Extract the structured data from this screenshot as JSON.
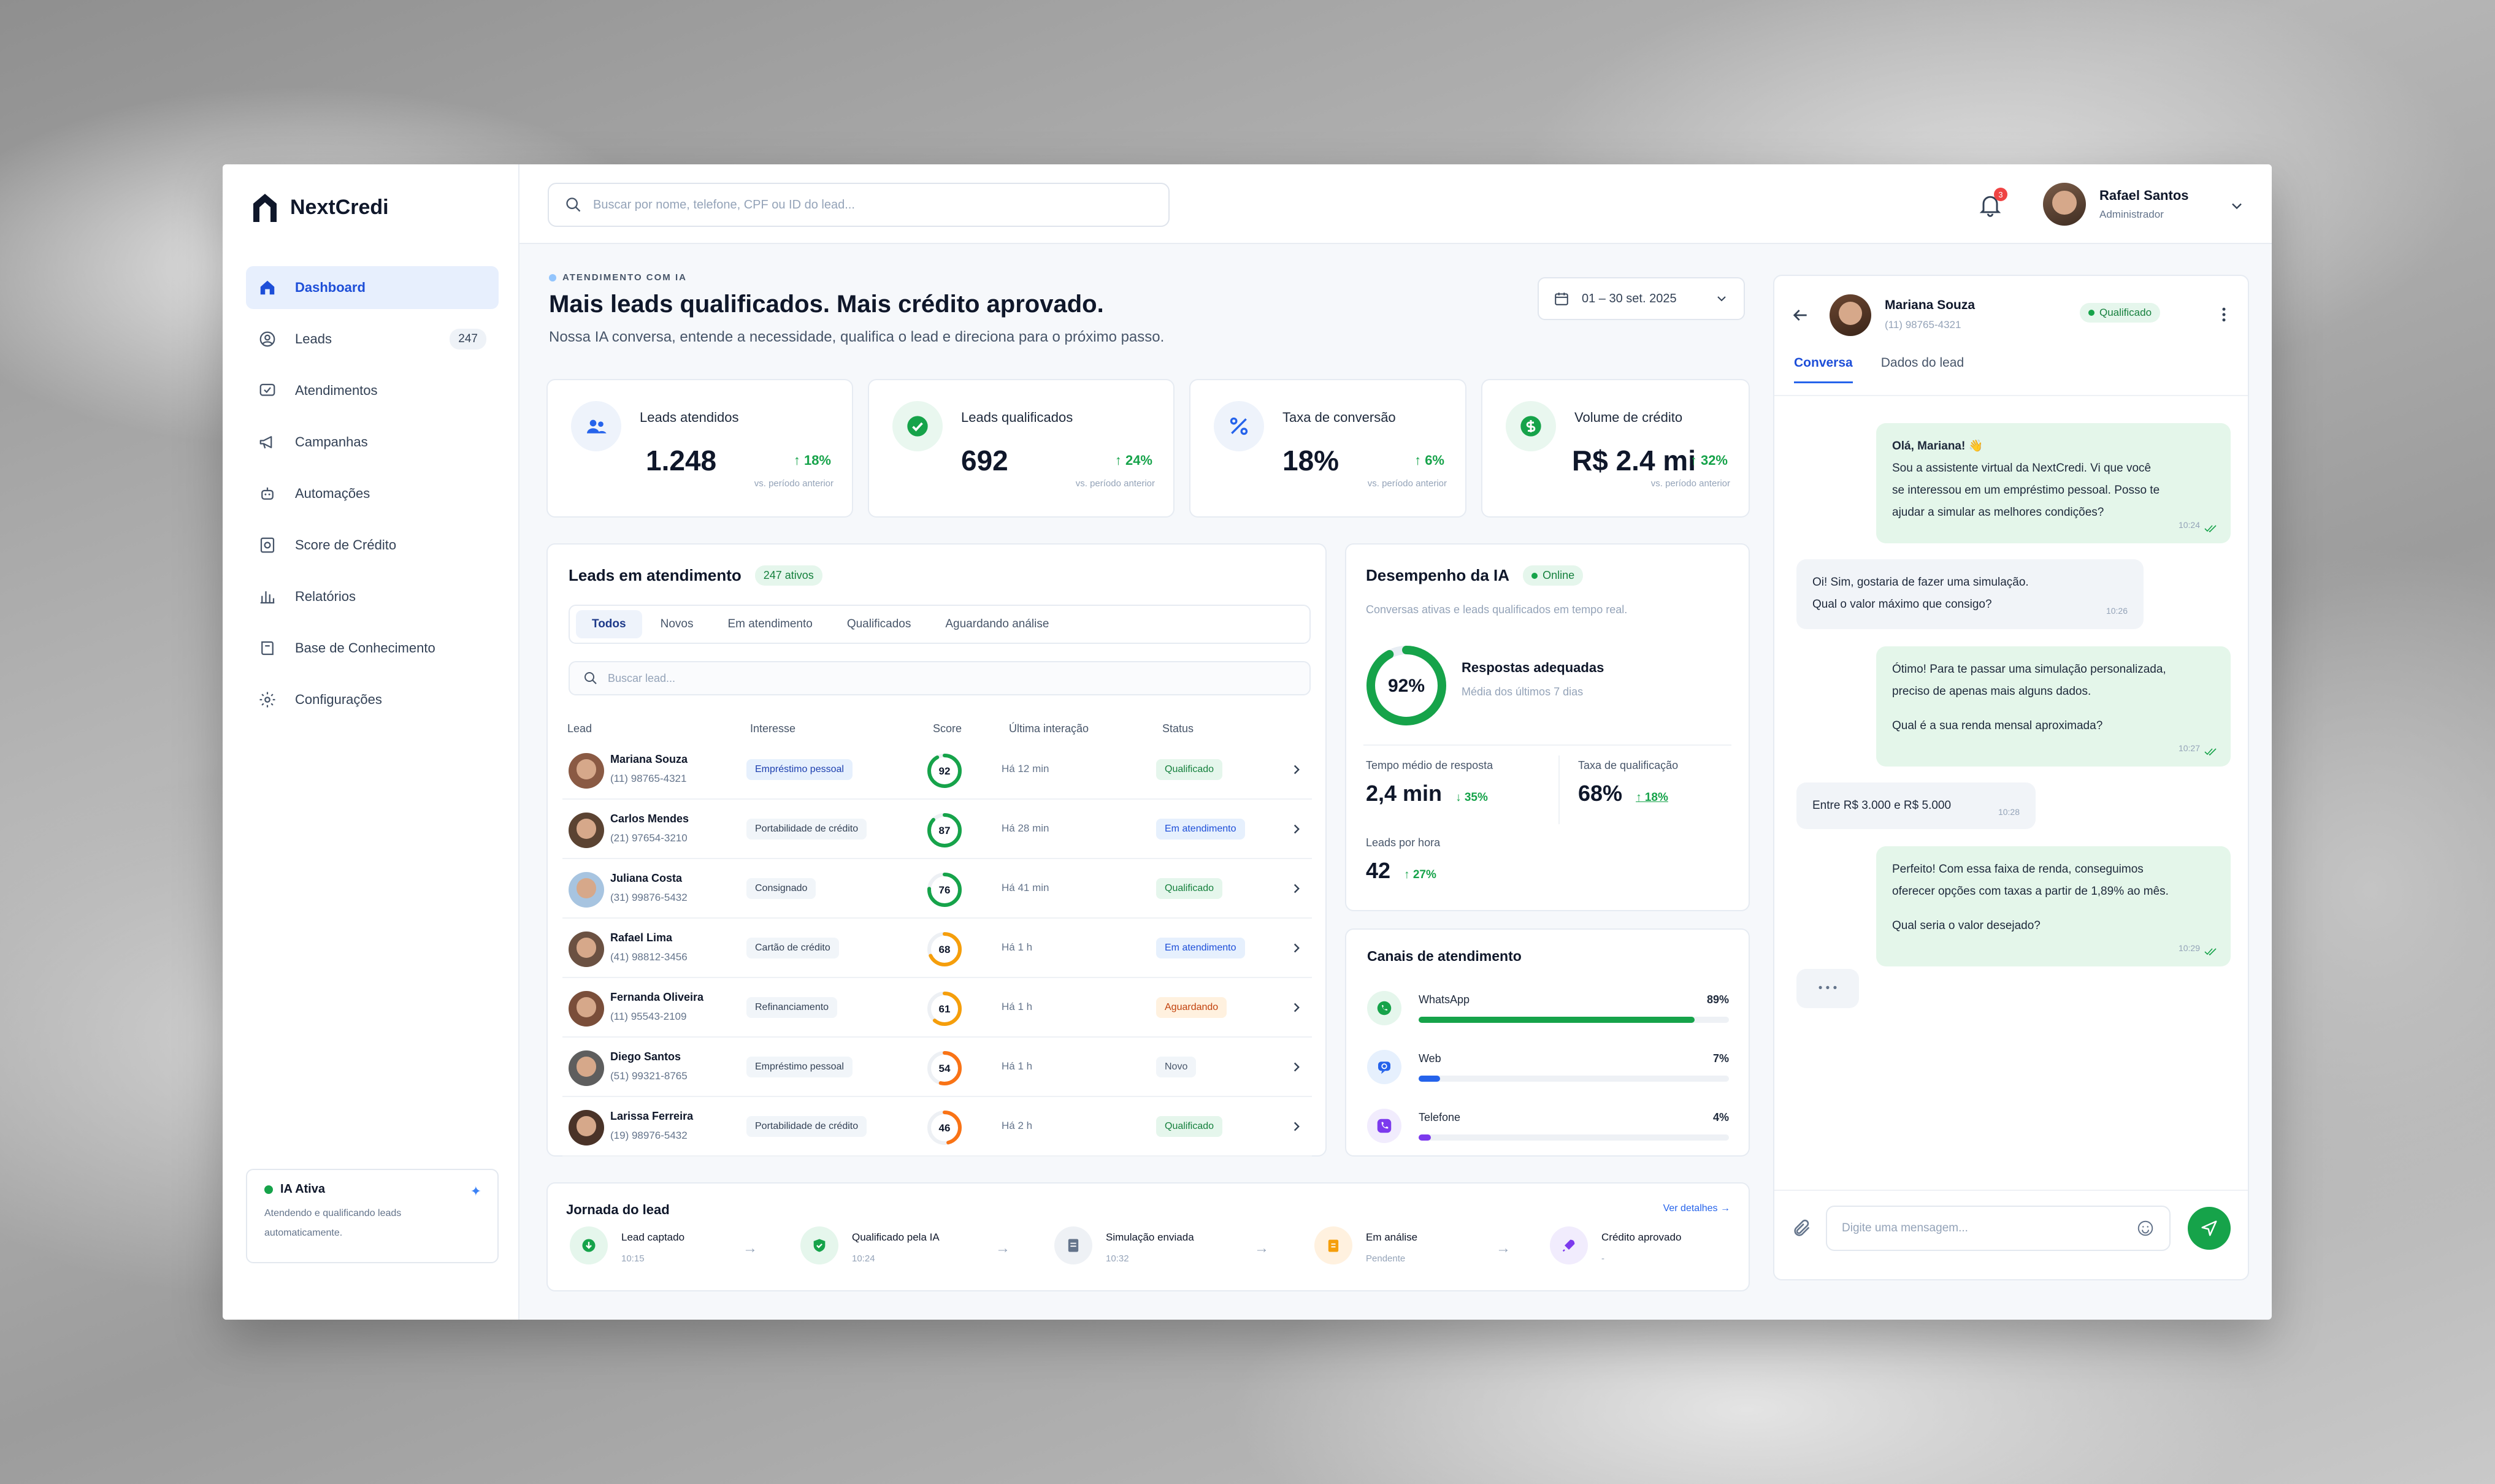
{
  "brand": {
    "name": "NextCredi"
  },
  "search": {
    "placeholder": "Buscar por nome, telefone, CPF ou ID do lead..."
  },
  "notifications": {
    "count": "3"
  },
  "user": {
    "name": "Rafael Santos",
    "role": "Administrador"
  },
  "sidebar": {
    "items": [
      {
        "label": "Dashboard",
        "icon": "home-icon",
        "active": true
      },
      {
        "label": "Leads",
        "icon": "user-circle-icon",
        "badge": "247"
      },
      {
        "label": "Atendimentos",
        "icon": "chat-icon"
      },
      {
        "label": "Campanhas",
        "icon": "megaphone-icon"
      },
      {
        "label": "Automações",
        "icon": "robot-icon"
      },
      {
        "label": "Score de Crédito",
        "icon": "score-icon"
      },
      {
        "label": "Relatórios",
        "icon": "bar-chart-icon"
      },
      {
        "label": "Base de Conhecimento",
        "icon": "book-icon"
      },
      {
        "label": "Configurações",
        "icon": "gear-icon"
      }
    ],
    "ia_card": {
      "title": "IA Ativa",
      "desc": "Atendendo e qualificando leads automaticamente."
    }
  },
  "header": {
    "eyebrow": "ATENDIMENTO COM IA",
    "title": "Mais leads qualificados. Mais crédito aprovado.",
    "subtitle": "Nossa IA conversa, entende a necessidade, qualifica o lead e direciona para o próximo passo.",
    "date_range": "01 – 30 set. 2025"
  },
  "kpis": [
    {
      "label": "Leads atendidos",
      "value": "1.248",
      "delta": "↑ 18%",
      "note": "vs. período anterior",
      "icon": "users-icon",
      "color": "#2563eb"
    },
    {
      "label": "Leads qualificados",
      "value": "692",
      "delta": "↑ 24%",
      "note": "vs. período anterior",
      "icon": "check-circle-icon",
      "color": "#16a34a"
    },
    {
      "label": "Taxa de conversão",
      "value": "18%",
      "delta": "↑ 6%",
      "note": "vs. período anterior",
      "icon": "percent-icon",
      "color": "#2563eb"
    },
    {
      "label": "Volume de crédito",
      "value": "R$ 2.4 mi",
      "delta": "↑ 32%",
      "note": "vs. período anterior",
      "icon": "dollar-icon",
      "color": "#16a34a"
    }
  ],
  "leads": {
    "title": "Leads em atendimento",
    "active_badge": "247 ativos",
    "tabs": [
      "Todos",
      "Novos",
      "Em atendimento",
      "Qualificados",
      "Aguardando análise"
    ],
    "search_placeholder": "Buscar lead...",
    "columns": [
      "Lead",
      "Interesse",
      "Score",
      "Última interação",
      "Status"
    ],
    "rows": [
      {
        "name": "Mariana Souza",
        "phone": "(11) 98765-4321",
        "interest": "Empréstimo pessoal",
        "score": 92,
        "last": "Há 12 min",
        "status": "Qualificado",
        "kind": "q",
        "blue": true
      },
      {
        "name": "Carlos Mendes",
        "phone": "(21) 97654-3210",
        "interest": "Portabilidade de crédito",
        "score": 87,
        "last": "Há 28 min",
        "status": "Em atendimento",
        "kind": "a",
        "blue": false
      },
      {
        "name": "Juliana Costa",
        "phone": "(31) 99876-5432",
        "interest": "Consignado",
        "score": 76,
        "last": "Há 41 min",
        "status": "Qualificado",
        "kind": "q",
        "blue": false
      },
      {
        "name": "Rafael Lima",
        "phone": "(41) 98812-3456",
        "interest": "Cartão de crédito",
        "score": 68,
        "last": "Há 1 h",
        "status": "Em atendimento",
        "kind": "a",
        "blue": false
      },
      {
        "name": "Fernanda Oliveira",
        "phone": "(11) 95543-2109",
        "interest": "Refinanciamento",
        "score": 61,
        "last": "Há 1 h",
        "status": "Aguardando",
        "kind": "w",
        "blue": false
      },
      {
        "name": "Diego Santos",
        "phone": "(51) 99321-8765",
        "interest": "Empréstimo pessoal",
        "score": 54,
        "last": "Há 1 h",
        "status": "Novo",
        "kind": "n",
        "blue": false
      },
      {
        "name": "Larissa Ferreira",
        "phone": "(19) 98976-5432",
        "interest": "Portabilidade de crédito",
        "score": 46,
        "last": "Há 2 h",
        "status": "Qualificado",
        "kind": "q",
        "blue": false
      }
    ]
  },
  "journey": {
    "title": "Jornada do lead",
    "link": "Ver detalhes →",
    "steps": [
      {
        "title": "Lead captado",
        "sub": "10:15",
        "icon": "download-icon",
        "bg": "#e5f6ec",
        "fg": "#16a34a"
      },
      {
        "title": "Qualificado pela IA",
        "sub": "10:24",
        "icon": "shield-check-icon",
        "bg": "#e5f6ec",
        "fg": "#16a34a"
      },
      {
        "title": "Simulação enviada",
        "sub": "10:32",
        "icon": "document-icon",
        "bg": "#eef1f5",
        "fg": "#64748b"
      },
      {
        "title": "Em análise",
        "sub": "Pendente",
        "icon": "clipboard-icon",
        "bg": "#fff1df",
        "fg": "#f59e0b"
      },
      {
        "title": "Crédito aprovado",
        "sub": "-",
        "icon": "rocket-icon",
        "bg": "#f1ecfd",
        "fg": "#7c3aed"
      }
    ]
  },
  "performance": {
    "title": "Desempenho da IA",
    "status": "Online",
    "subtitle": "Conversas ativas e leads qualificados em tempo real.",
    "ring_value": 0.92,
    "ring_label": "92%",
    "ring_title": "Respostas adequadas",
    "ring_sub": "Média dos últimos 7 dias",
    "metrics": [
      {
        "label": "Tempo médio de resposta",
        "value": "2,4 min",
        "delta": "↓ 35%"
      },
      {
        "label": "Taxa de qualificação",
        "value": "68%",
        "delta": "↑ 18%"
      },
      {
        "label": "Leads por hora",
        "value": "42",
        "delta": "↑ 27%"
      }
    ]
  },
  "channels": {
    "title": "Canais de atendimento",
    "items": [
      {
        "name": "WhatsApp",
        "pct": "89%",
        "value": 0.89,
        "color": "#16a34a",
        "icon": "whatsapp-icon",
        "bg": "#e5f6ec"
      },
      {
        "name": "Web",
        "pct": "7%",
        "value": 0.07,
        "color": "#2563eb",
        "icon": "globe-chat-icon",
        "bg": "#e6f0fd"
      },
      {
        "name": "Telefone",
        "pct": "4%",
        "value": 0.04,
        "color": "#7c3aed",
        "icon": "phone-icon",
        "bg": "#f1ecfd"
      }
    ]
  },
  "chat": {
    "contact_name": "Mariana Souza",
    "contact_phone": "(11) 98765-4321",
    "contact_status": "Qualificado",
    "tabs": [
      "Conversa",
      "Dados do lead"
    ],
    "messages": [
      {
        "from": "me",
        "lines": [
          "Olá, Mariana! 👋",
          "Sou a assistente virtual da NextCredi. Vi que você",
          "se interessou em um empréstimo pessoal. Posso te",
          "ajudar a simular as melhores condições?"
        ],
        "time": "10:24"
      },
      {
        "from": "them",
        "lines": [
          "Oi! Sim, gostaria de fazer uma simulação.",
          "Qual o valor máximo que consigo?"
        ],
        "time": "10:26"
      },
      {
        "from": "me",
        "lines": [
          "Ótimo! Para te passar uma simulação personalizada,",
          "preciso de apenas mais alguns dados.",
          "",
          "Qual é a sua renda mensal aproximada?"
        ],
        "time": "10:27"
      },
      {
        "from": "them",
        "lines": [
          "Entre R$ 3.000 e R$ 5.000"
        ],
        "time": "10:28"
      },
      {
        "from": "me",
        "lines": [
          "Perfeito! Com essa faixa de renda, conseguimos",
          "oferecer opções com taxas a partir de 1,89% ao mês.",
          "",
          "Qual seria o valor desejado?"
        ],
        "time": "10:29"
      }
    ],
    "typing": "• • •",
    "input_placeholder": "Digite uma mensagem..."
  }
}
